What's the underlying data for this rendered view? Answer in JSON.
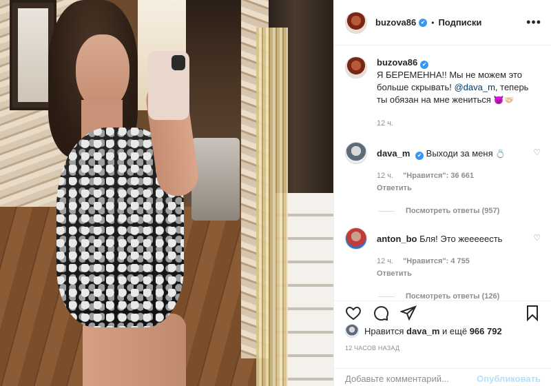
{
  "post": {
    "author": "buzova86",
    "verified_mark": "✔",
    "dot": "•",
    "follow_label": "Подписки",
    "more_icon": "more-horizontal-icon"
  },
  "caption": {
    "author": "buzova86",
    "text_1": "Я БЕРЕМЕННА!! Мы не можем это больше скрывать!",
    "mention": "@dava_m",
    "text_2": ", теперь ты обязан на мне жениться",
    "emoji": "😈🤝🏻",
    "time": "12 ч."
  },
  "comments": [
    {
      "author": "dava_m",
      "text": "Выходи за меня",
      "emoji": "💍",
      "time": "12 ч.",
      "likes": "\"Нравится\": 36 661",
      "reply": "Ответить",
      "view_replies": "Посмотреть ответы (957)"
    },
    {
      "author": "anton_bo",
      "text": "Бля! Это жееееесть",
      "emoji": "",
      "time": "12 ч.",
      "likes": "\"Нравится\": 4 755",
      "reply": "Ответить",
      "view_replies": "Посмотреть ответы (126)"
    }
  ],
  "actions": {
    "icons": [
      "heart-icon",
      "comment-icon",
      "share-icon",
      "bookmark-icon"
    ]
  },
  "likes": {
    "prefix": "Нравится",
    "user": "dava_m",
    "middle": "и ещё",
    "count": "966 792"
  },
  "timestamp": "12 ЧАСОВ НАЗАД",
  "add_comment": {
    "placeholder": "Добавьте комментарий...",
    "post_label": "Опубликовать"
  },
  "colors": {
    "verified": "#3897f0",
    "mention": "#00376b",
    "muted": "#8e8e8e",
    "post_button_disabled": "#b2dffc"
  }
}
